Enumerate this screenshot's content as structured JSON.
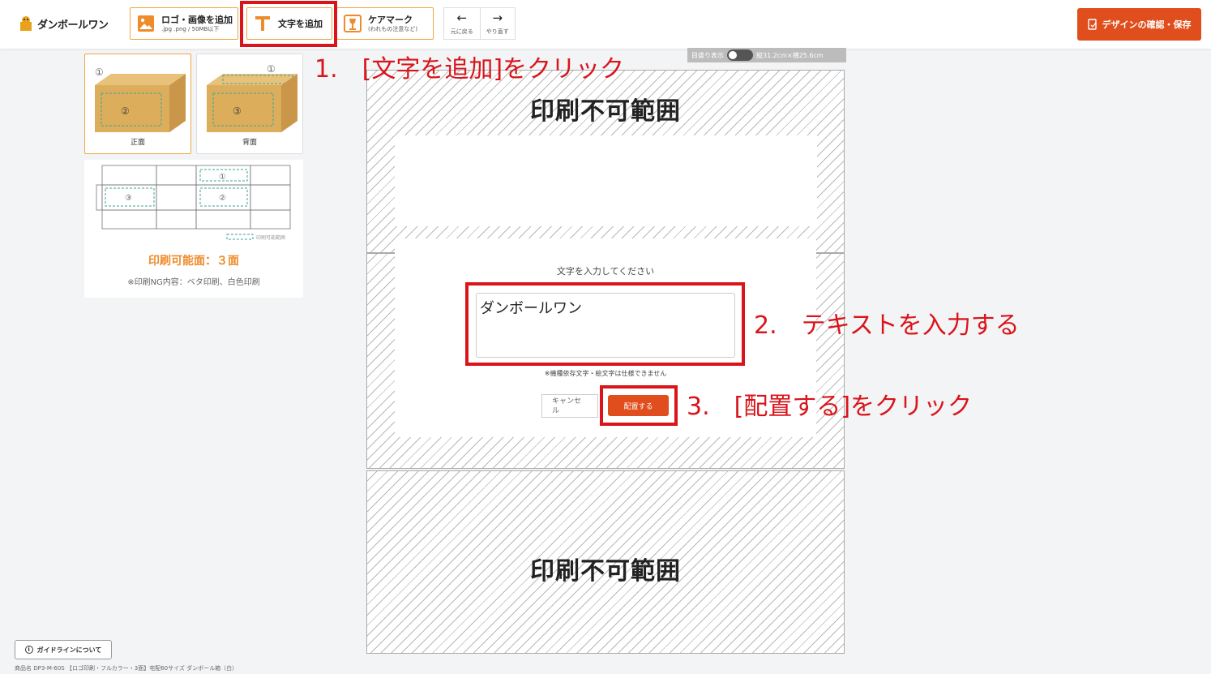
{
  "header": {
    "logo_text": "ダンボールワン",
    "tools": [
      {
        "title": "ロゴ・画像を追加",
        "sub": ".jpg .png / 50MB以下",
        "icon": "image-icon"
      },
      {
        "title": "文字を追加",
        "icon": "text-t-icon"
      },
      {
        "title": "ケアマーク",
        "sub": "(われもの注意など)",
        "icon": "care-mark-icon"
      }
    ],
    "undo_label": "元に戻る",
    "redo_label": "やり直す",
    "save_label": "デザインの確認・保存"
  },
  "left": {
    "faces": [
      {
        "label": "正面",
        "num_a": "①",
        "num_b": "②"
      },
      {
        "label": "背面",
        "num_a": "①",
        "num_b": "③"
      }
    ],
    "unfold_nums": [
      "①",
      "③",
      "②"
    ],
    "legend": "印刷可能範囲",
    "printable_title": "印刷可能面：３面",
    "ng_note": "※印刷NG内容：ベタ印刷、白色印刷",
    "guide_label": "ガイドラインについて",
    "product_name": "商品名 DP3-M-60S 【ロゴ印刷・フルカラー・3面】宅配60サイズ ダンボール箱（白）"
  },
  "canvas": {
    "ruler_label": "目盛り表示",
    "size_label": "縦31.2cm×横25.6cm",
    "nonprint_label": "印刷不可範囲"
  },
  "dialog": {
    "prompt": "文字を入力してください",
    "text_value": "ダンボールワン",
    "warning": "※機種依存文字・絵文字は仕様できません",
    "cancel_label": "キャンセル",
    "place_label": "配置する"
  },
  "annotations": {
    "step1": "1.　[文字を追加]をクリック",
    "step2": "2.　テキストを入力する",
    "step3": "3.　[配置する]をクリック"
  },
  "colors": {
    "accent": "#e04e1d",
    "tool_border": "#f0a640",
    "annotation_red": "#d9141b",
    "printable_orange": "#ee8b2a"
  }
}
